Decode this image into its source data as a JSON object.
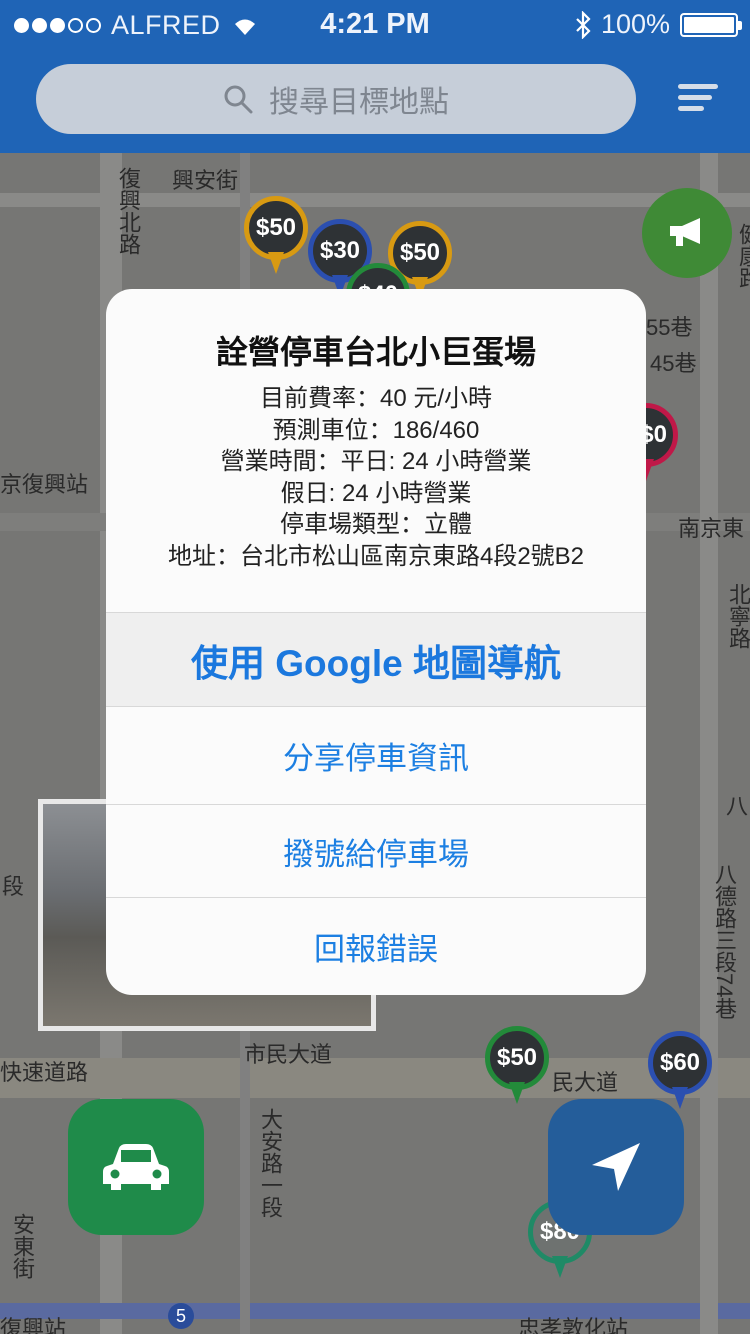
{
  "status_bar": {
    "carrier": "ALFRED",
    "time": "4:21 PM",
    "battery": "100%"
  },
  "search": {
    "placeholder": "搜尋目標地點"
  },
  "map": {
    "labels": {
      "xingan": "興安街",
      "fuxing_north": "復興北路",
      "fuxing_station": "京復興站",
      "nanjing_east": "南京東",
      "lane55": "55巷",
      "lane45": "45巷",
      "beining": "北寧路",
      "jiankang": "健康路",
      "lane74": "八德路三段74巷",
      "ba": "八",
      "duan": "段",
      "civic": "市民大道",
      "civic_right": "民大道",
      "expressway": "快速道路",
      "daan": "大安路一段",
      "andong": "安東街",
      "fuxing_bottom": "復興站",
      "zhongxiao": "忠孝敦化站",
      "route5": "5"
    },
    "pins": {
      "p1": "$50",
      "p2": "$30",
      "p3": "$50",
      "p4": "$40",
      "p5": "$50",
      "p6": "$60",
      "p7": "$80",
      "p8": "$0"
    }
  },
  "dialog": {
    "title": "詮營停車台北小巨蛋場",
    "info": [
      "目前費率：40 元/小時",
      "預測車位：186/460",
      "營業時間：平日: 24 小時營業",
      "假日: 24 小時營業",
      "停車場類型：立體",
      "地址：台北市松山區南京東路4段2號B2"
    ],
    "actions": {
      "navigate": "使用 Google 地圖導航",
      "share": "分享停車資訊",
      "call": "撥號給停車場",
      "report": "回報錯誤"
    }
  },
  "colors": {
    "brand": "#1f64b6",
    "link": "#1c7fe2",
    "car_button": "#1f8b4a",
    "nav_button": "#245d9a"
  }
}
